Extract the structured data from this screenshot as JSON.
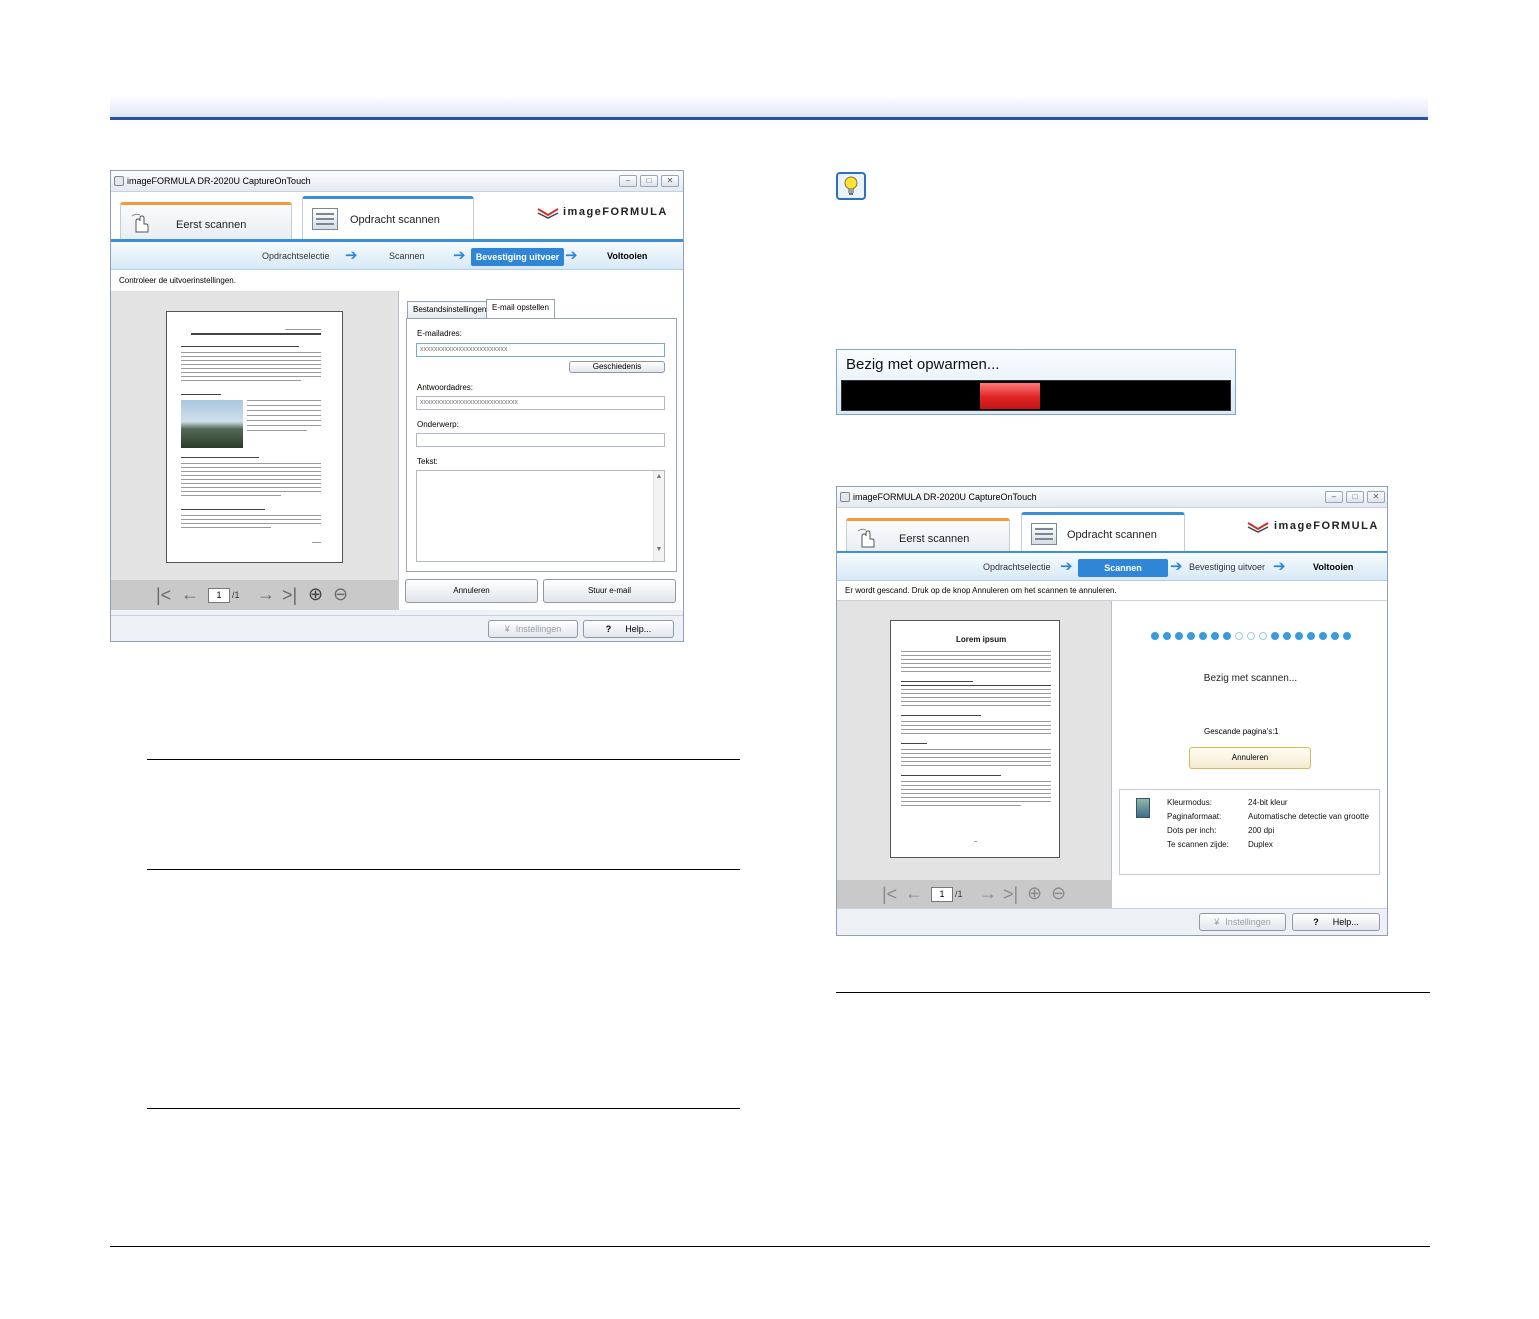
{
  "win1": {
    "title": "imageFORMULA DR-2020U CaptureOnTouch",
    "tabs": [
      {
        "label": "Eerst scannen"
      },
      {
        "label": "Opdracht scannen"
      }
    ],
    "brand": "imageFORMULA",
    "steps": [
      {
        "label": "Opdrachtselectie"
      },
      {
        "label": "Scannen"
      },
      {
        "label": "Bevestiging uitvoer"
      },
      {
        "label": "Voltooien"
      }
    ],
    "active_step": "Bevestiging uitvoer",
    "instruction": "Controleer de uitvoerinstellingen.",
    "inner_tabs": [
      {
        "label": "Bestandsinstellingen"
      },
      {
        "label": "E-mail opstellen"
      }
    ],
    "email_label": "E-mailadres:",
    "email_value": "xxxxxxxxxxxxxxxxxxxxxxxxx",
    "history_button": "Geschiedenis",
    "reply_label": "Antwoordadres:",
    "reply_value": "xxxxxxxxxxxxxxxxxxxxxxxxxxxx",
    "subject_label": "Onderwerp:",
    "subject_value": "",
    "text_label": "Tekst:",
    "cancel_button": "Annuleren",
    "send_button": "Stuur e-mail",
    "settings_button": "Instellingen",
    "help_button": "Help...",
    "page_num": "1",
    "page_total": "/1"
  },
  "warmup": {
    "text": "Bezig met opwarmen...",
    "colors": {
      "bar": "#000000",
      "fill": "#e02424"
    }
  },
  "win2": {
    "title": "imageFORMULA DR-2020U CaptureOnTouch",
    "tabs": [
      {
        "label": "Eerst scannen"
      },
      {
        "label": "Opdracht scannen"
      }
    ],
    "brand": "imageFORMULA",
    "steps": [
      {
        "label": "Opdrachtselectie"
      },
      {
        "label": "Scannen"
      },
      {
        "label": "Bevestiging uitvoer"
      },
      {
        "label": "Voltooien"
      }
    ],
    "active_step": "Scannen",
    "instruction": "Er wordt gescand. Druk op de knop Annuleren om het scannen te annuleren.",
    "doc_title": "Lorem ipsum",
    "status": "Bezig met scannen...",
    "scanned_pages_label": "Gescande pagina's:",
    "scanned_pages_value": "1",
    "cancel_button": "Annuleren",
    "info": [
      {
        "label": "Kleurmodus:",
        "value": "24-bit kleur"
      },
      {
        "label": "Paginaformaat:",
        "value": "Automatische detectie van grootte"
      },
      {
        "label": "Dots per inch:",
        "value": "200 dpi"
      },
      {
        "label": "Te scannen zijde:",
        "value": "Duplex"
      }
    ],
    "progress_dots": 17,
    "progress_dots_active_pattern": [
      1,
      1,
      1,
      1,
      1,
      1,
      1,
      0,
      0,
      0,
      1,
      1,
      1,
      1,
      1,
      1,
      1
    ],
    "settings_button": "Instellingen",
    "help_button": "Help...",
    "page_num": "1",
    "page_total": "/1"
  },
  "icons": {
    "tip": "lightbulb-icon",
    "hand": "hand-pointer-icon",
    "job": "job-list-icon",
    "scanner": "scanner-icon"
  },
  "colors": {
    "accent": "#2f86d6",
    "header_rule": "#2c4fa8",
    "tab_orange": "#f09a3e"
  }
}
